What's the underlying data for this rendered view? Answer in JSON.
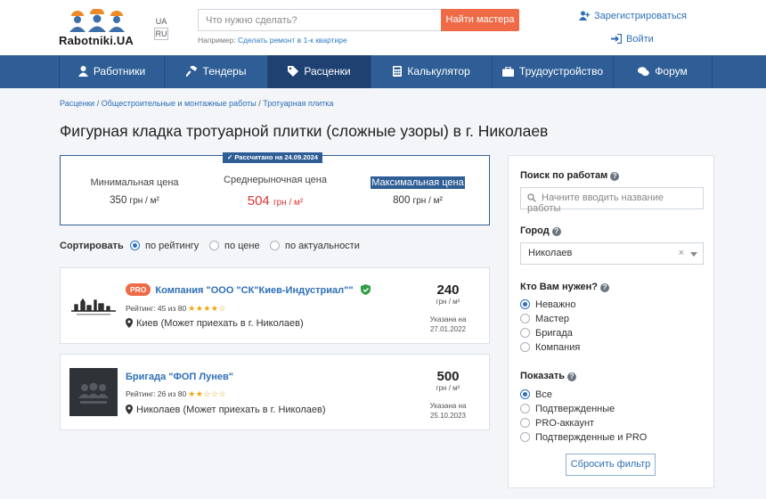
{
  "header": {
    "logo_text": "Rabotniki.UA",
    "lang_ua": "UA",
    "lang_ru": "RU",
    "search_placeholder": "Что нужно сделать?",
    "search_button": "Найти мастера",
    "hint_prefix": "Например:",
    "hint_link": "Сделать ремонт в 1-к квартире",
    "register": "Зарегистрироваться",
    "login": "Войти"
  },
  "nav": [
    {
      "label": "Работники",
      "icon": "worker-icon"
    },
    {
      "label": "Тендеры",
      "icon": "hammer-icon"
    },
    {
      "label": "Расценки",
      "icon": "tag-icon",
      "active": true
    },
    {
      "label": "Калькулятор",
      "icon": "calculator-icon"
    },
    {
      "label": "Трудоустройство",
      "icon": "briefcase-icon"
    },
    {
      "label": "Форум",
      "icon": "chat-icon"
    }
  ],
  "breadcrumb": [
    "Расценки",
    "Общестроительные и монтажные работы",
    "Тротуарная плитка"
  ],
  "page_title": "Фигурная кладка тротуарной плитки (сложные узоры) в г. Николаев",
  "prices": {
    "badge": "✓ Рассчитано на 24.09.2024",
    "min_label": "Минимальная цена",
    "min_value": "350",
    "avg_label": "Среднерыночная цена",
    "avg_value": "504",
    "max_label": "Максимальная цена",
    "max_value": "800",
    "unit": "грн / м²"
  },
  "sort": {
    "title": "Сортировать",
    "options": [
      "по рейтингу",
      "по цене",
      "по актуальности"
    ],
    "selected": 0
  },
  "listings": [
    {
      "pro_badge": "PRO",
      "name": "Компания \"ООО \"СК\"Киев-Индустриал\"\"",
      "rating_text": "Рейтинг: 45 из 80",
      "stars": 4,
      "city": "Киев (Может приехать в г. Николаев)",
      "price": "240",
      "unit": "грн / м²",
      "date_label": "Указана на",
      "date": "27.01.2022"
    },
    {
      "name": "Бригада \"ФОП Лунев\"",
      "rating_text": "Рейтинг: 26 из 80",
      "stars": 2,
      "city": "Николаев (Может приехать в г. Николаев)",
      "price": "500",
      "unit": "грн / м²",
      "date_label": "Указана на",
      "date": "25.10.2023"
    }
  ],
  "sidebar": {
    "search_title": "Поиск по работам",
    "search_placeholder": "Начните вводить название работы",
    "city_title": "Город",
    "city_value": "Николаев",
    "who_title": "Кто Вам нужен?",
    "who_options": [
      "Неважно",
      "Мастер",
      "Бригада",
      "Компания"
    ],
    "show_title": "Показать",
    "show_options": [
      "Все",
      "Подтвержденные",
      "PRO-аккаунт",
      "Подтвержденные и PRO"
    ],
    "reset_button": "Сбросить фильтр"
  },
  "colors": {
    "nav": "#2f5e96",
    "accent": "#ef6a46",
    "link": "#2d6fb6",
    "price_avg": "#d33333"
  }
}
